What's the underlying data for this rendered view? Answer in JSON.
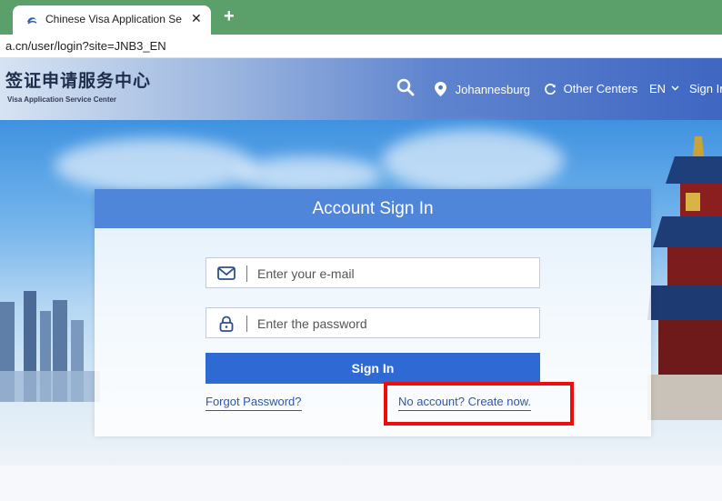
{
  "browser": {
    "tab_title": "Chinese Visa Application Service",
    "tab_close": "✕",
    "new_tab": "+",
    "url": "a.cn/user/login?site=JNB3_EN"
  },
  "header": {
    "logo_cn": "签证申请服务中心",
    "logo_en": "Visa Application Service Center",
    "nav": {
      "location": "Johannesburg",
      "other_centers": "Other Centers",
      "language": "EN",
      "sign_in": "Sign In"
    }
  },
  "login": {
    "title": "Account Sign In",
    "email_placeholder": "Enter your e-mail",
    "password_placeholder": "Enter the password",
    "submit_label": "Sign In",
    "forgot_password": "Forgot Password?",
    "create_account": "No account? Create now."
  },
  "colors": {
    "tab_bar": "#5b9f6a",
    "header_accent": "#3f67c2",
    "card_header": "#4f86d9",
    "primary_button": "#2f6ad4",
    "link": "#2e56b0",
    "highlight": "#ee0d0d"
  },
  "icons": {
    "favicon": "site-favicon-icon",
    "search": "search-icon",
    "location": "location-pin-icon",
    "refresh": "refresh-icon",
    "language_dropdown": "chevron-down-icon",
    "email": "envelope-icon",
    "password": "lock-icon"
  }
}
